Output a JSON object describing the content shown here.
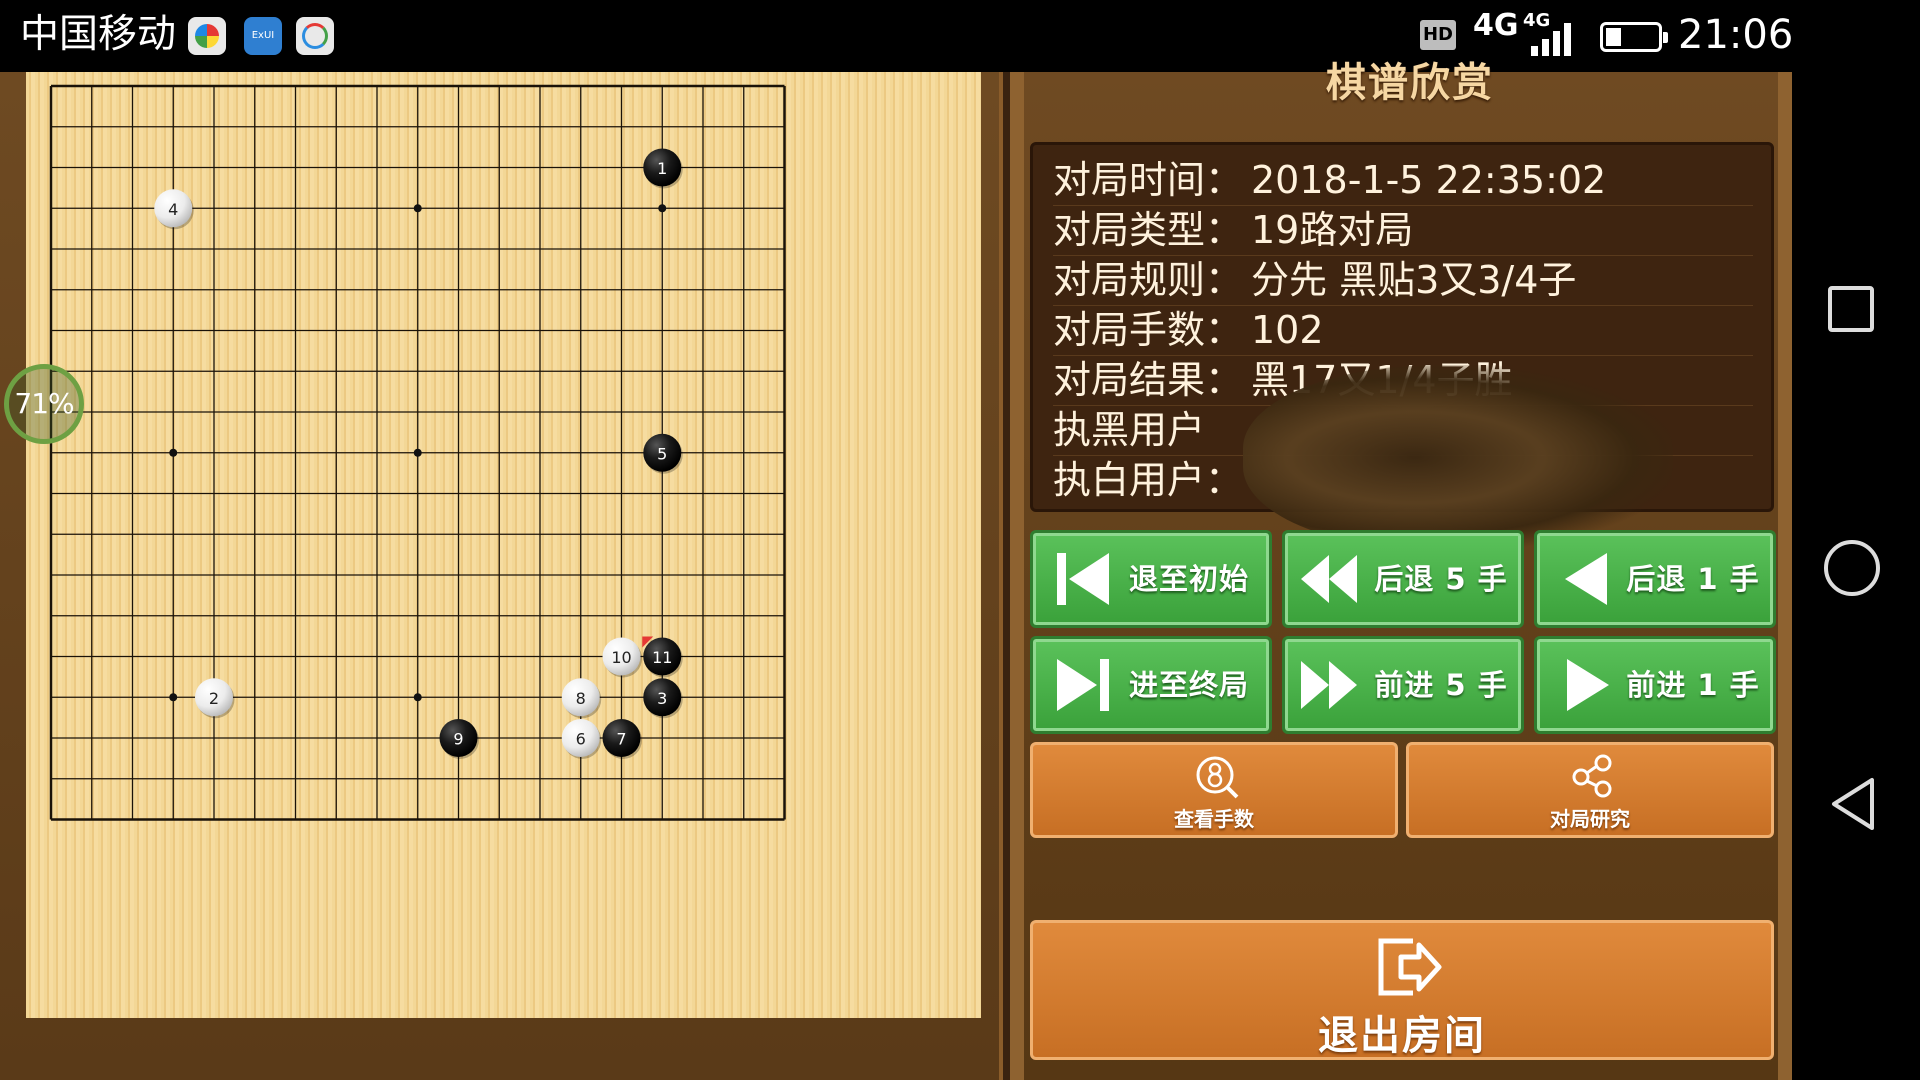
{
  "status_bar": {
    "carrier": "中国移动",
    "app_icon_2_text": "ExUI",
    "hd_badge": "HD",
    "network_1": "4G",
    "network_2": "4G",
    "battery_level": 0.3,
    "time": "21:06"
  },
  "board": {
    "size": 19,
    "progress_text": "71%",
    "star_points": [
      [
        3,
        3
      ],
      [
        3,
        9
      ],
      [
        3,
        15
      ],
      [
        9,
        3
      ],
      [
        9,
        9
      ],
      [
        9,
        15
      ],
      [
        15,
        3
      ],
      [
        15,
        9
      ],
      [
        15,
        15
      ]
    ],
    "stones": [
      {
        "num": "1",
        "color": "black",
        "col": 15,
        "row": 2
      },
      {
        "num": "2",
        "color": "white",
        "col": 4,
        "row": 15
      },
      {
        "num": "3",
        "color": "black",
        "col": 15,
        "row": 15
      },
      {
        "num": "4",
        "color": "white",
        "col": 3,
        "row": 3
      },
      {
        "num": "5",
        "color": "black",
        "col": 15,
        "row": 9
      },
      {
        "num": "6",
        "color": "white",
        "col": 13,
        "row": 16
      },
      {
        "num": "7",
        "color": "black",
        "col": 14,
        "row": 16
      },
      {
        "num": "8",
        "color": "white",
        "col": 13,
        "row": 15
      },
      {
        "num": "9",
        "color": "black",
        "col": 10,
        "row": 16
      },
      {
        "num": "10",
        "color": "white",
        "col": 14,
        "row": 14
      },
      {
        "num": "11",
        "color": "black",
        "col": 15,
        "row": 14
      }
    ],
    "last_move_marker_color": "#e53935"
  },
  "panel": {
    "title": "棋谱欣赏",
    "info": [
      {
        "label": "对局时间：",
        "value": "2018-1-5 22:35:02"
      },
      {
        "label": "对局类型：",
        "value": "19路对局"
      },
      {
        "label": "对局规则：",
        "value": "分先 黑贴3又3/4子"
      },
      {
        "label": "对局手数：",
        "value": "102"
      },
      {
        "label": "对局结果：",
        "value": "黑17又1/4子胜"
      },
      {
        "label": "执黑用户",
        "value": ""
      },
      {
        "label": "执白用户：",
        "value": ""
      }
    ],
    "controls": [
      {
        "label": "退至初始",
        "icon": "skip-to-start-icon"
      },
      {
        "label": "后退 5 手",
        "icon": "rewind-icon"
      },
      {
        "label": "后退 1 手",
        "icon": "step-back-icon"
      },
      {
        "label": "进至终局",
        "icon": "skip-to-end-icon"
      },
      {
        "label": "前进 5 手",
        "icon": "fast-forward-icon"
      },
      {
        "label": "前进 1 手",
        "icon": "step-forward-icon"
      }
    ],
    "view_moves_label": "查看手数",
    "study_label": "对局研究",
    "exit_label": "退出房间"
  },
  "colors": {
    "green_button": "#4db34d",
    "orange_button": "#d47b2e",
    "wood_dark": "#5a3a18"
  }
}
